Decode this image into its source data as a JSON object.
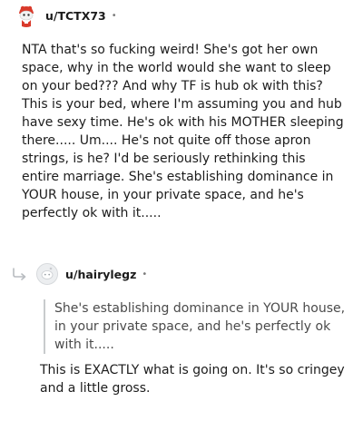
{
  "top_comment": {
    "username": "u/TCTX73",
    "separator": "•",
    "body": "NTA that's so fucking weird! She's got her own space, why in the world would she want to sleep on your bed??? And why TF is hub ok with this? This is your bed, where I'm assuming you and hub have sexy time. He's ok with his MOTHER sleeping there..... Um.... He's not quite off those apron strings, is he? I'd be seriously rethinking this entire marriage. She's establishing dominance in YOUR house, in your private space, and he's perfectly ok with it....."
  },
  "reply_comment": {
    "username": "u/hairylegz",
    "separator": "•",
    "quote": "She's establishing dominance in YOUR house, in your private space, and he's perfectly ok with it.....",
    "body": "This is EXACTLY what is going on. It's so cringey and a little gross."
  },
  "icons": {
    "top_avatar": "reddit-snoo-avatar-icon",
    "reply_arrow": "reply-arrow-icon",
    "reply_avatar": "default-avatar-icon"
  },
  "colors": {
    "text": "#1c1c1c",
    "meta": "#7c7c7c",
    "quote_bar": "#c8cbcd",
    "avatar_red": "#d93a2b"
  }
}
